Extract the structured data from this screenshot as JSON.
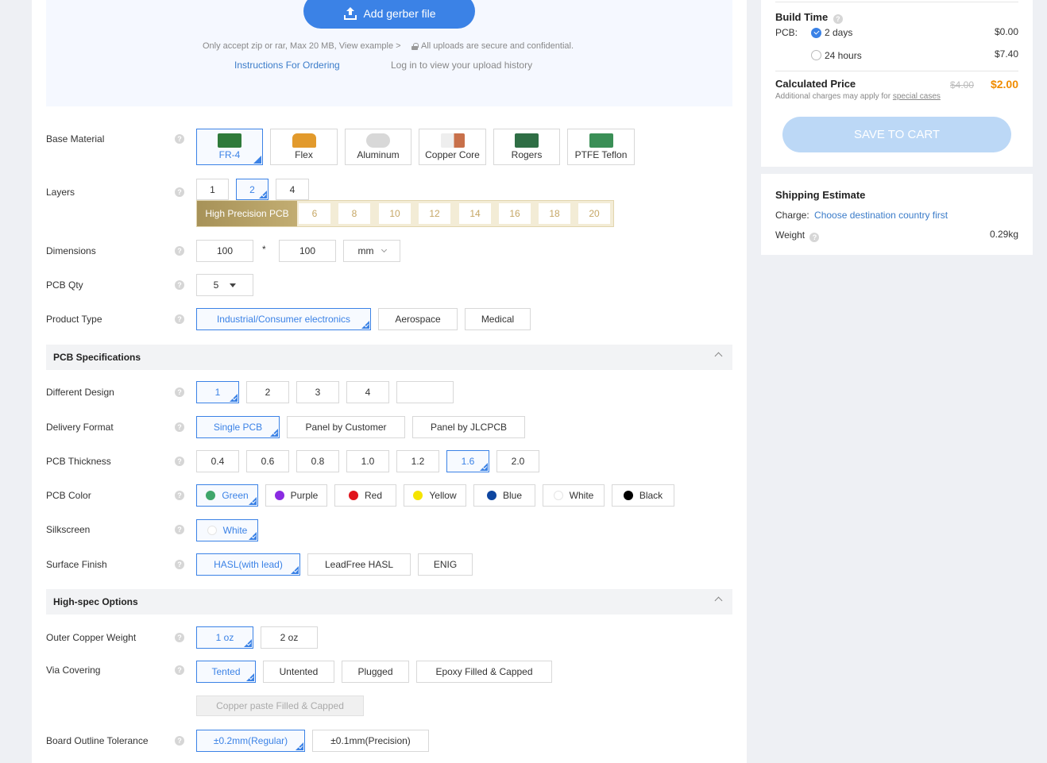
{
  "upload": {
    "button_label": "Add gerber file",
    "note_accept": "Only accept zip or rar, Max 20 MB, View example >",
    "note_secure": "All uploads are secure and confidential.",
    "instructions_link": "Instructions For Ordering",
    "history_link": "Log in to view your upload history"
  },
  "base_material": {
    "label": "Base Material",
    "options": [
      "FR-4",
      "Flex",
      "Aluminum",
      "Copper Core",
      "Rogers",
      "PTFE Teflon"
    ],
    "selected": "FR-4"
  },
  "layers": {
    "label": "Layers",
    "options": [
      "1",
      "2",
      "4"
    ],
    "selected": "2",
    "high_precision_label": "High Precision PCB",
    "high_precision_options": [
      "6",
      "8",
      "10",
      "12",
      "14",
      "16",
      "18",
      "20"
    ]
  },
  "dimensions": {
    "label": "Dimensions",
    "width": "100",
    "times": "*",
    "height": "100",
    "unit": "mm"
  },
  "pcb_qty": {
    "label": "PCB Qty",
    "value": "5"
  },
  "product_type": {
    "label": "Product Type",
    "options": [
      "Industrial/Consumer electronics",
      "Aerospace",
      "Medical"
    ],
    "selected": "Industrial/Consumer electronics"
  },
  "pcb_specs": {
    "title": "PCB Specifications",
    "different_design": {
      "label": "Different Design",
      "options": [
        "1",
        "2",
        "3",
        "4"
      ],
      "selected": "1"
    },
    "delivery_format": {
      "label": "Delivery Format",
      "options": [
        "Single PCB",
        "Panel by Customer",
        "Panel by JLCPCB"
      ],
      "selected": "Single PCB"
    },
    "thickness": {
      "label": "PCB Thickness",
      "options": [
        "0.4",
        "0.6",
        "0.8",
        "1.0",
        "1.2",
        "1.6",
        "2.0"
      ],
      "selected": "1.6"
    },
    "color": {
      "label": "PCB Color",
      "options": [
        {
          "name": "Green",
          "hex": "#3fa66b"
        },
        {
          "name": "Purple",
          "hex": "#8a2be2"
        },
        {
          "name": "Red",
          "hex": "#e0141c"
        },
        {
          "name": "Yellow",
          "hex": "#f5e400"
        },
        {
          "name": "Blue",
          "hex": "#0e46a0"
        },
        {
          "name": "White",
          "hex": "#ffffff"
        },
        {
          "name": "Black",
          "hex": "#000000"
        }
      ],
      "selected": "Green"
    },
    "silkscreen": {
      "label": "Silkscreen",
      "value": "White"
    },
    "surface_finish": {
      "label": "Surface Finish",
      "options": [
        "HASL(with lead)",
        "LeadFree HASL",
        "ENIG"
      ],
      "selected": "HASL(with lead)"
    }
  },
  "high_spec": {
    "title": "High-spec Options",
    "outer_copper": {
      "label": "Outer Copper Weight",
      "options": [
        "1 oz",
        "2 oz"
      ],
      "selected": "1 oz"
    },
    "via_covering": {
      "label": "Via Covering",
      "options": [
        "Tented",
        "Untented",
        "Plugged",
        "Epoxy Filled & Capped",
        "Copper paste Filled & Capped"
      ],
      "selected": "Tented"
    },
    "outline_tolerance": {
      "label": "Board Outline Tolerance",
      "options": [
        "±0.2mm(Regular)",
        "±0.1mm(Precision)"
      ],
      "selected": "±0.2mm(Regular)"
    }
  },
  "summary": {
    "build_time_title": "Build Time",
    "pcb_label": "PCB:",
    "options": [
      {
        "label": "2 days",
        "price": "$0.00"
      },
      {
        "label": "24 hours",
        "price": "$7.40"
      }
    ],
    "calc_title": "Calculated Price",
    "old_price": "$4.00",
    "new_price": "$2.00",
    "additional_note": "Additional charges may apply for",
    "special_cases": "special cases",
    "save_button": "SAVE TO CART"
  },
  "shipping": {
    "title": "Shipping Estimate",
    "charge_label": "Charge:",
    "charge_link": "Choose destination country first",
    "weight_label": "Weight",
    "weight_value": "0.29kg"
  },
  "colors": {
    "accent": "#3b82e6",
    "price_orange": "#f08c00",
    "gold": "#c6a766"
  }
}
